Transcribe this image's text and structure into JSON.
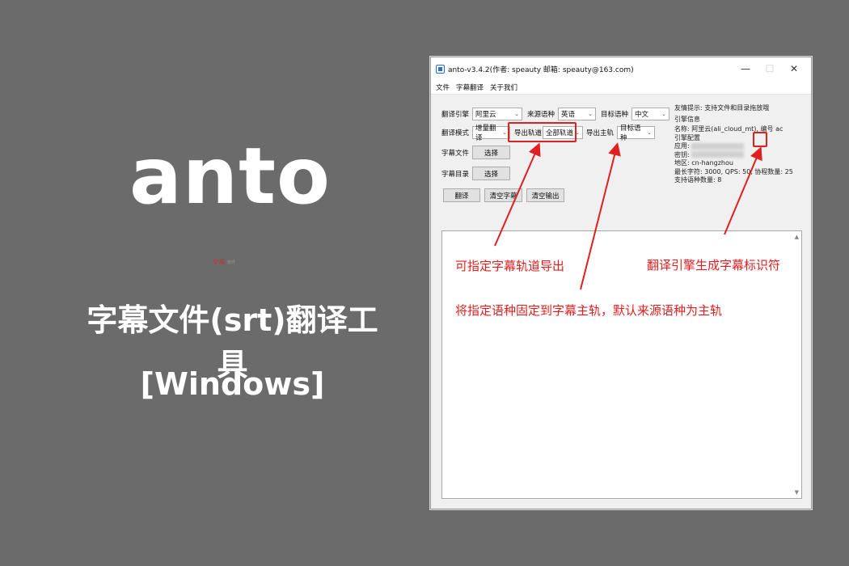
{
  "promo": {
    "brand": "anto",
    "small_logo_main": "小众",
    "small_logo_sub": "软件",
    "subtitle": "字幕文件(srt)翻译工具",
    "platform": "[Windows]"
  },
  "window": {
    "title": "anto-v3.4.2(作者: speauty 邮箱: speauty@163.com)",
    "controls": {
      "minimize": "—",
      "maximize": "☐",
      "close": "✕"
    },
    "menu": [
      "文件",
      "字幕翻译",
      "关于我们"
    ]
  },
  "form": {
    "engine_label": "翻译引擎",
    "engine_value": "阿里云",
    "source_lang_label": "来源语种",
    "source_lang_value": "英语",
    "target_lang_label": "目标语种",
    "target_lang_value": "中文",
    "mode_label": "翻译模式",
    "mode_value": "增量翻译",
    "export_track_label": "导出轨道",
    "export_track_value": "全部轨道",
    "main_track_label": "导出主轨",
    "main_track_value": "目标语种",
    "subtitle_file_label": "字幕文件",
    "subtitle_dir_label": "字幕目录",
    "choose_label": "选择",
    "translate_btn": "翻译",
    "clear_subtitle_btn": "清空字幕",
    "clear_output_btn": "清空输出"
  },
  "info": {
    "tip": "友情提示: 支持文件和目录拖放哦",
    "engine_info_title": "引擎信息",
    "name_line_prefix": "名称: 阿里云(ali_cloud_mt), 编号",
    "engine_code": "ac",
    "config_title": "引擎配置",
    "app_label": "应用:",
    "key_label": "密钥:",
    "region_line": "地区: cn-hangzhou",
    "limits_line": "最长字符: 3000, QPS: 50, 协程数量: 25",
    "langs_line": "支持语种数量: 8"
  },
  "annotations": {
    "export_track": "可指定字幕轨道导出",
    "main_track": "将指定语种固定到字幕主轨，默认来源语种为主轨",
    "engine_code": "翻译引擎生成字幕标识符"
  },
  "colors": {
    "background": "#6b6b6b",
    "annotation": "#e02020",
    "window_bg": "#f0f0f0"
  },
  "icons": {
    "app": "app-icon",
    "dropdown": "chevron-down-icon",
    "scroll_up": "scroll-up-icon",
    "scroll_down": "scroll-down-icon"
  }
}
